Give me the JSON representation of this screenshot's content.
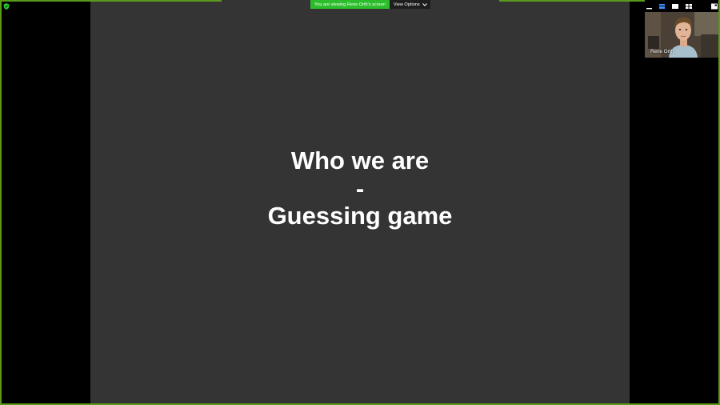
{
  "share_banner": {
    "text": "You are viewing Rene Orth's screen"
  },
  "view_options": {
    "label": "View Options",
    "icon": "chevron-down-icon"
  },
  "slide": {
    "lines": [
      "Who we are",
      "-",
      "Guessing game"
    ]
  },
  "participant": {
    "name": "Rene Orth"
  },
  "layout_controls": [
    "minimize-icon",
    "speaker-view-icon",
    "single-view-icon",
    "gallery-view-icon",
    "exit-fullscreen-icon"
  ],
  "colors": {
    "accent_green": "#5a9a1a",
    "banner_green": "#2bbd2b",
    "slide_bg": "#343434",
    "background": "#000000"
  }
}
